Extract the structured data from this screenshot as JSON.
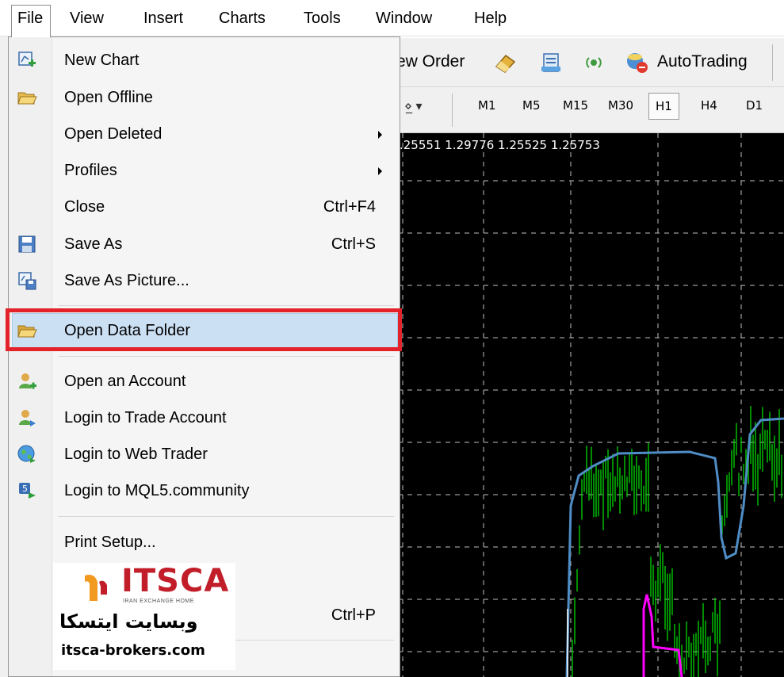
{
  "menubar": {
    "items": [
      "File",
      "View",
      "Insert",
      "Charts",
      "Tools",
      "Window",
      "Help"
    ],
    "active": "File"
  },
  "toolbar": {
    "new_order_partial": "ew Order",
    "autotrading": "AutoTrading",
    "timeframes": [
      "M1",
      "M5",
      "M15",
      "M30",
      "H1",
      "H4",
      "D1"
    ],
    "selected_timeframe": "H1"
  },
  "chart": {
    "ohlc": ".25551 1.29776 1.25525 1.25753",
    "background": "#000000",
    "grid_color": "#c0c0c0",
    "bar_color": "#00c800",
    "line_blue": "#4f8dc6",
    "line_magenta": "#ff00ff"
  },
  "file_menu": {
    "items": [
      {
        "label": "New Chart",
        "icon": "new-chart-icon",
        "shortcut": "",
        "submenu": false
      },
      {
        "label": "Open Offline",
        "icon": "open-folder-icon",
        "shortcut": "",
        "submenu": false
      },
      {
        "label": "Open Deleted",
        "icon": "",
        "shortcut": "",
        "submenu": true
      },
      {
        "label": "Profiles",
        "icon": "",
        "shortcut": "",
        "submenu": true
      },
      {
        "label": "Close",
        "icon": "",
        "shortcut": "Ctrl+F4",
        "submenu": false
      },
      {
        "label": "Save As",
        "icon": "floppy-disk-icon",
        "shortcut": "Ctrl+S",
        "submenu": false
      },
      {
        "label": "Save As Picture...",
        "icon": "save-picture-icon",
        "shortcut": "",
        "submenu": false
      },
      {
        "label": "Open Data Folder",
        "icon": "folder-icon",
        "shortcut": "",
        "submenu": false,
        "highlighted": true
      },
      {
        "label": "Open an Account",
        "icon": "user-add-icon",
        "shortcut": "",
        "submenu": false
      },
      {
        "label": "Login to Trade Account",
        "icon": "user-login-icon",
        "shortcut": "",
        "submenu": false
      },
      {
        "label": "Login to Web Trader",
        "icon": "globe-icon",
        "shortcut": "",
        "submenu": false
      },
      {
        "label": "Login to MQL5.community",
        "icon": "mql5-icon",
        "shortcut": "",
        "submenu": false
      },
      {
        "label": "Print Setup...",
        "icon": "",
        "shortcut": "",
        "submenu": false
      },
      {
        "label": "",
        "icon": "",
        "shortcut": "Ctrl+P",
        "submenu": false
      }
    ]
  },
  "watermark": {
    "brand": "ITSCA",
    "tagline": "IRAN EXCHANGE HOME",
    "persian": "وبسایت ایتسکا",
    "url": "itsca-brokers.com",
    "accent": "#c21e2a"
  },
  "annotation": {
    "highlight_color": "#e32229"
  }
}
